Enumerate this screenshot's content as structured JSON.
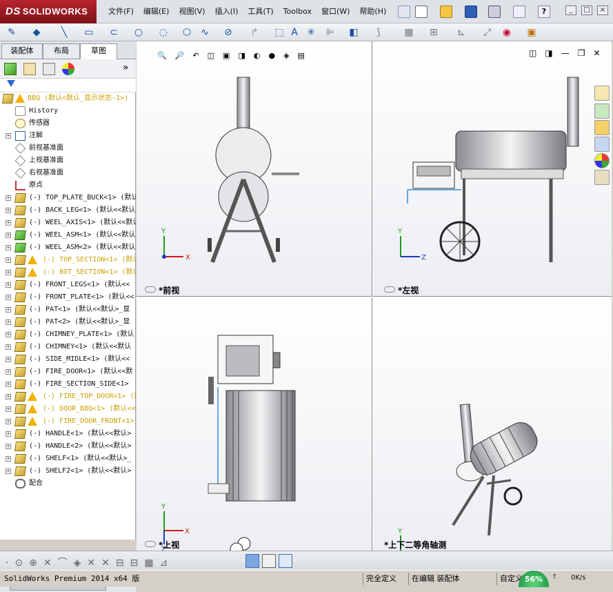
{
  "app": {
    "logo_ds": "DS",
    "logo_name": "SOLIDWORKS"
  },
  "menu": [
    "文件(F)",
    "编辑(E)",
    "视图(V)",
    "插入(I)",
    "工具(T)",
    "Toolbox",
    "窗口(W)",
    "帮助(H)"
  ],
  "tabs": [
    "装配体",
    "布局",
    "草图"
  ],
  "tree": {
    "root": "BBQ  (默认<默认_显示状态-1>)",
    "items": [
      {
        "t": "History",
        "k": "hist"
      },
      {
        "t": "传感器",
        "k": "sens"
      },
      {
        "t": "注解",
        "k": "anno",
        "exp": true
      },
      {
        "t": "前视基准面",
        "k": "plane"
      },
      {
        "t": "上视基准面",
        "k": "plane"
      },
      {
        "t": "右视基准面",
        "k": "plane"
      },
      {
        "t": "原点",
        "k": "origin"
      },
      {
        "t": "(-) TOP_PLATE_BUCK<1> (默认<",
        "k": "asm",
        "exp": true
      },
      {
        "t": "(-) BACK_LEG<1> (默认<<默认",
        "k": "asm",
        "exp": true
      },
      {
        "t": "(-) WEEL_AXIS<1> (默认<<默认",
        "k": "asm",
        "exp": true
      },
      {
        "t": "(-) WEEL_ASM<1> (默认<<默认",
        "k": "asmg",
        "exp": true
      },
      {
        "t": "(-) WEEL_ASM<2> (默认<<默认",
        "k": "asmg",
        "exp": true
      },
      {
        "t": "(-) TOP_SECTION<1> (默认",
        "k": "warn",
        "exp": true
      },
      {
        "t": "(-) BOT_SECTION<1> (默认",
        "k": "warn",
        "exp": true
      },
      {
        "t": "(-) FRONT_LEGS<1> (默认<<",
        "k": "asm",
        "exp": true
      },
      {
        "t": "(-) FRONT_PLATE<1> (默认<<",
        "k": "asm",
        "exp": true
      },
      {
        "t": "(-) PAT<1> (默认<<默认>_显",
        "k": "asm",
        "exp": true
      },
      {
        "t": "(-) PAT<2> (默认<<默认>_显",
        "k": "asm",
        "exp": true
      },
      {
        "t": "(-) CHIMNEY_PLATE<1> (默认",
        "k": "asm",
        "exp": true
      },
      {
        "t": "(-) CHIMNEY<1> (默认<<默认",
        "k": "asm",
        "exp": true
      },
      {
        "t": "(-) SIDE_MIDLE<1> (默认<<",
        "k": "asm",
        "exp": true
      },
      {
        "t": "(-) FIRE_DOOR<1> (默认<<默",
        "k": "asm",
        "exp": true
      },
      {
        "t": "(-) FIRE_SECTION_SIDE<1>",
        "k": "asm",
        "exp": true
      },
      {
        "t": "(-) FIRE_TOP_DOOR<1> (默",
        "k": "warn",
        "exp": true
      },
      {
        "t": "(-) DOOR_BBQ<1> (默认<<",
        "k": "warn",
        "exp": true
      },
      {
        "t": "(-) FIRE_DOOR_FRONT<1>",
        "k": "warn",
        "exp": true
      },
      {
        "t": "(-) HANDLE<1> (默认<<默认>",
        "k": "asm",
        "exp": true
      },
      {
        "t": "(-) HANDLE<2> (默认<<默认>",
        "k": "asm",
        "exp": true
      },
      {
        "t": "(-) SHELF<1> (默认<<默认>_",
        "k": "asm",
        "exp": true
      },
      {
        "t": "(-) SHELF2<1> (默认<<默认>",
        "k": "asm",
        "exp": true
      },
      {
        "t": "配合",
        "k": "mate"
      }
    ]
  },
  "views": {
    "front": "*前视",
    "left": "*左视",
    "top": "*上视",
    "iso": "*上下二等角轴测"
  },
  "axes": {
    "x": "X",
    "y": "Y",
    "z": "Z"
  },
  "status": {
    "app": "SolidWorks Premium 2014 x64 版",
    "def": "完全定义",
    "edit": "在编辑 装配体",
    "custom": "自定义",
    "pct": "56%",
    "speed": "0K/s"
  }
}
